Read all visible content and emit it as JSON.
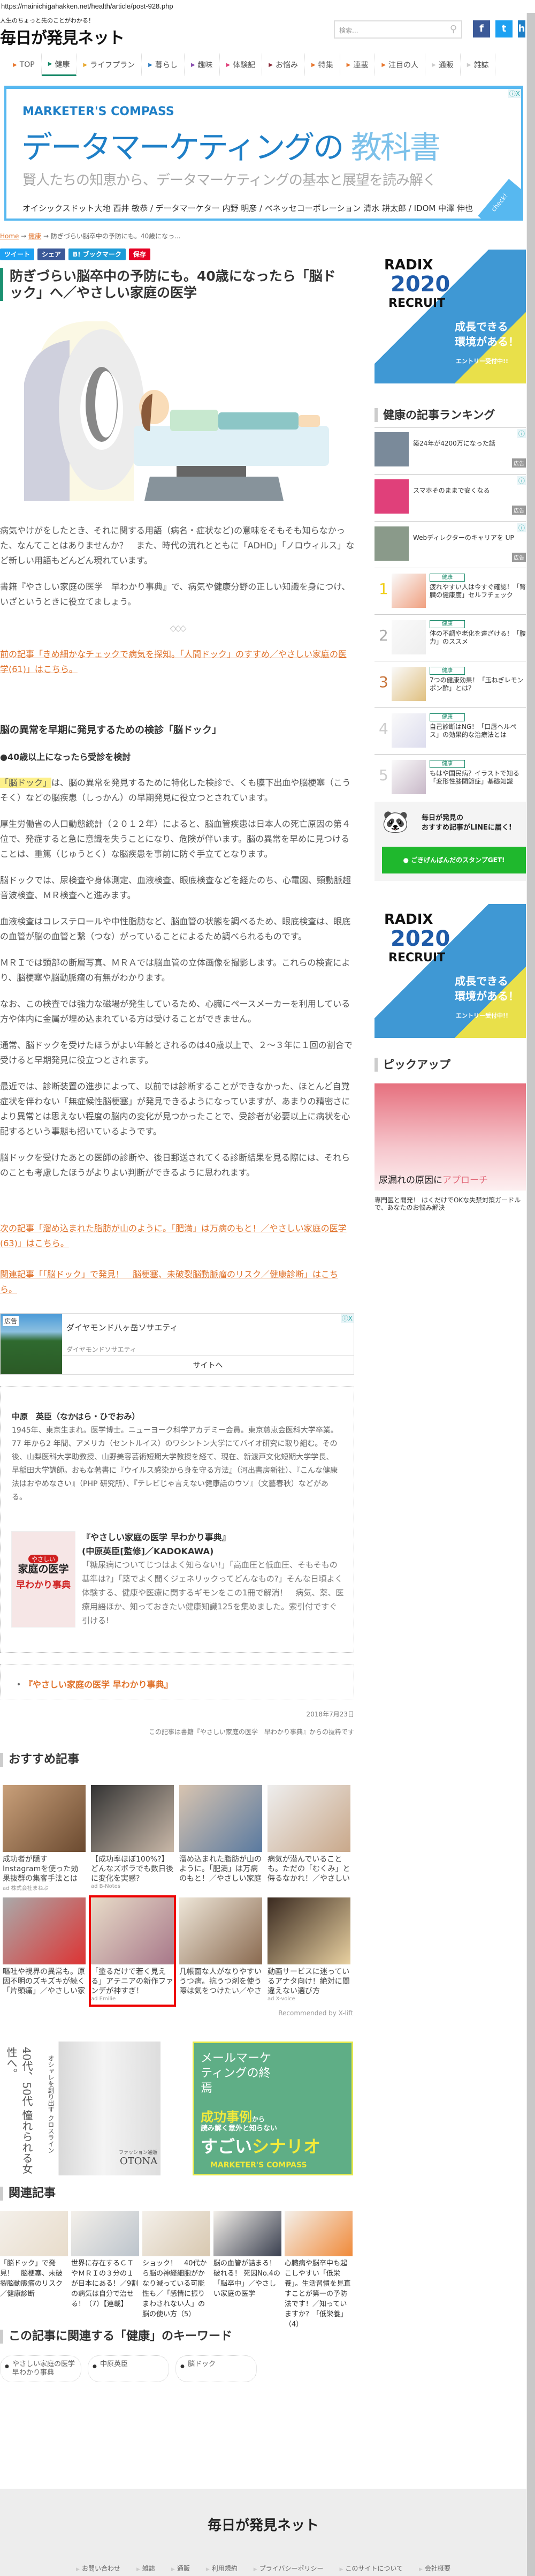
{
  "browser": {
    "url": "https://mainichigahakken.net/health/article/post-928.php"
  },
  "header": {
    "tagline": "人生のちょっと先のことがわかる！",
    "logo": "毎日が発見ネット",
    "search_placeholder": "検索...",
    "social": [
      "f",
      "t",
      "h"
    ]
  },
  "nav": [
    {
      "label": "TOP",
      "color": "#e8772e"
    },
    {
      "label": "健康",
      "color": "#1a8a6a",
      "active": true
    },
    {
      "label": "ライフプラン",
      "color": "#e8a82e"
    },
    {
      "label": "暮らし",
      "color": "#2b7bc0"
    },
    {
      "label": "趣味",
      "color": "#8a4fb0"
    },
    {
      "label": "体験記",
      "color": "#e0407a"
    },
    {
      "label": "お悩み",
      "color": "#8a2b3a"
    },
    {
      "label": "特集",
      "color": "#e8772e"
    },
    {
      "label": "連載",
      "color": "#e8772e"
    },
    {
      "label": "注目の人",
      "color": "#e8772e"
    },
    {
      "label": "通販",
      "color": "#ccc"
    },
    {
      "label": "雑誌",
      "color": "#ccc"
    }
  ],
  "top_ad": {
    "brand": "MARKETER'S COMPASS",
    "headline": "データマーケティングの",
    "headline_accent": "教科書",
    "sub": "賢人たちの知恵から、データマーケティングの基本と展望を読み解く",
    "names": "オイシックスドット大地 西井 敏恭 / データマーケター 内野 明彦 / ベネッセコーポレーション 清水 耕太郎 / IDOM 中澤 伸也",
    "check": "check!",
    "info": "ⓘX"
  },
  "breadcrumb": {
    "home": "Home",
    "cat": "健康",
    "current": "防ぎづらい脳卒中の予防にも。40歳になっ...",
    "sep": "→"
  },
  "share": [
    {
      "label": "ツイート",
      "color": "#1da1f2"
    },
    {
      "label": "シェア",
      "color": "#3b5998"
    },
    {
      "label": "B! ブックマーク",
      "color": "#1e9bd7"
    },
    {
      "label": "保存",
      "color": "#e60023"
    }
  ],
  "article": {
    "title": "防ぎづらい脳卒中の予防にも。40歳になったら「脳ドック」へ／やさしい家庭の医学",
    "intro": [
      "病気やけがをしたとき、それに関する用語（病名・症状など)の意味をそもそも知らなかった、なんてことはありませんか？　また、時代の流れとともに「ADHD」「ノロウィルス」など新しい用語もどんどん現れています。",
      "書籍『やさしい家庭の医学　早わかり事典』で、病気や健康分野の正しい知識を身につけ、いざというときに役立てましょう。"
    ],
    "divider": "◇◇◇",
    "prev_link": "前の記事「きめ細かなチェックで病気を探知。「人間ドック」のすすめ／やさしい家庭の医学(61)」はこちら。",
    "h3": "脳の異常を早期に発見するための検診「脳ドック」",
    "h4": "●40歳以上になったら受診を検討",
    "p1_highlight": "「脳ドック」",
    "p1_rest": "は、脳の異常を発見するために特化した検診で、くも膜下出血や脳梗塞（こうそく）などの脳疾患（しっかん）の早期発見に役立つとされています。",
    "paras": [
      "厚生労働省の人口動態統計（２０１２年）によると、脳血管疾患は日本人の死亡原因の第４位で、発症すると急に意識を失うことになり、危険が伴います。脳の異常を早めに見つけることは、重篤（じゅうとく）な脳疾患を事前に防ぐ手立てとなります。",
      "脳ドックでは、尿検査や身体測定、血液検査、眼底検査などを経たのち、心電図、頸動脈超音波検査、ＭＲ検査へと進みます。",
      "血液検査はコレステロールや中性脂肪など、脳血管の状態を調べるため、眼底検査は、眼底の血管が脳の血管と繋（つな）がっていることによるため調べられるものです。",
      "ＭＲＩでは頭部の断層写真、ＭＲＡでは脳血管の立体画像を撮影します。これらの検査により、脳梗塞や脳動脈瘤の有無がわかります。",
      "なお、この検査では強力な磁場が発生しているため、心臓にペースメーカーを利用している方や体内に金属が埋め込まれている方は受けることができません。",
      "通常、脳ドックを受けたほうがよい年齢とされるのは40歳以上で、２～３年に１回の割合で受けると早期発見に役立つとされます。",
      "最近では、診断装置の進歩によって、以前では診断することができなかった、ほとんど自覚症状を伴わない「無症候性脳梗塞」が発見できるようになっていますが、あまりの精密さにより異常とは思えない程度の脳内の変化が見つかったことで、受診者が必要以上に病状を心配するという事態も招いているようです。",
      "脳ドックを受けたあとの医師の診断や、後日郵送されてくる診断結果を見る際には、それらのことも考慮したほうがよりよい判断ができるように思われます。"
    ],
    "next_link": "次の記事「溜め込まれた脂肪が山のように。「肥満」は万病のもと！／やさしい家庭の医学(63)」はこちら。",
    "related_link": "関連記事「「脳ドック」で発見！　脳梗塞、未破裂脳動脈瘤のリスク／健康診断」はこちら。"
  },
  "inline_ad": {
    "tag": "広告",
    "title": "ダイヤモンド八ヶ岳ソサエティ",
    "advertiser": "ダイヤモンドソサエティ",
    "button": "サイトへ",
    "info": "ⓘX"
  },
  "author": {
    "name": "中原　英臣（なかはら・ひでおみ）",
    "bio": "1945年、東京生まれ。医学博士。ニューヨーク科学アカデミー会員。東京慈恵会医科大学卒業。77 年から2 年間、アメリカ（セントルイス）のワシントン大学にてバイオ研究に取り組む。その後、山梨医科大学助教授、山野美容芸術短期大学教授を経て、現在、新渡戸文化短期大学学長、早稲田大学講師。おもな著書に『ウイルス感染から身を守る方法』（河出書房新社）、『こんな健康法はおやめなさい』（PHP 研究所）、『テレビじゃ言えない健康話のウソ』（文藝春秋）などがある。",
    "book_cover": {
      "small": "やさしい",
      "main": "家庭の医学",
      "sub": "早わかり事典"
    },
    "book_title": "『やさしい家庭の医学 早わかり事典』",
    "book_pub": "(中原英臣[監修]／KADOKAWA)",
    "book_desc": "「糖尿病についてじつはよく知らない!」「高血圧と低血圧、そもそもの基準は?」「薬でよく聞くジェネリックってどんなもの?」そんな日頃よく体験する、健康や医療に関するギモンをこの1冊で解消！　病気、薬、医療用語ほか、知っておきたい健康知識125を集めました。索引付ですぐ引ける!"
  },
  "book_list": [
    "『やさしい家庭の医学 早わかり事典』"
  ],
  "date": "2018年7月23日",
  "source_note": "この記事は書籍『やさしい家庭の医学　早わかり事典』からの抜粋です",
  "recommend": {
    "heading": "おすすめ記事",
    "items": [
      {
        "title": "成功者が隠すInstagramを使った効果抜群の集客手法とは",
        "ad": "ad 株式会社まねぶ"
      },
      {
        "title": "【成功率ほぼ100%?】どんなズボラでも数日後に変化を実感?",
        "ad": "ad B-Notes"
      },
      {
        "title": "溜め込まれた脂肪が山のように。「肥満」は万病のもと！／やさしい家庭",
        "ad": ""
      },
      {
        "title": "病気が潜んでいることも。ただの「むくみ」と侮るなかれ！／やさしい",
        "ad": ""
      },
      {
        "title": "嘔吐や視界の異常も。原因不明のズキズキが続く「片頭痛」／やさしい家",
        "ad": ""
      },
      {
        "title": "「塗るだけで若く見える」アテニアの新作ファンデが神すぎ！",
        "ad": "ad Emilie",
        "selected": true
      },
      {
        "title": "几帳面な人がなりやすいうつ病。抗うつ剤を使う際は気をつけたい／やさ",
        "ad": ""
      },
      {
        "title": "動画サービスに迷っているアナタ向け！絶対に間違えない選び方",
        "ad": "ad X-voice"
      }
    ],
    "credit": "Recommended by X-lift"
  },
  "bottom_ads": {
    "left": {
      "vertical_main": "40代、50代 憧れられる女性へ。",
      "vertical_sub": "オシャレを創り出す クロスライン",
      "brand": "OTONA",
      "shop": "ファッション通販"
    },
    "right": {
      "title": "メールマーケティングの終焉",
      "accent": "成功事例",
      "from": "から",
      "sub": "読み解く意外と知らない",
      "big1": "すごい",
      "big2": "シナリオ",
      "brand": "MARKETER'S COMPASS"
    }
  },
  "related": {
    "heading": "関連記事",
    "items": [
      "「脳ドック」で発見！　脳梗塞、未破裂脳動脈瘤のリスク／健康診断",
      "世界に存在するＣＴやＭＲＩの３分の１が日本にある！／9割の病気は自分で治せる！（7）【連載】",
      "ショック！　40代から脳の神経細胞がかなり減っている可能性も／「感情に振りまわされない人」の脳の使い方（5）",
      "脳の血管が詰まる！破れる！ 死因No.4の「脳卒中」／やさしい家庭の医学",
      "心臓病や脳卒中も起こしやすい「低栄養」。生活習慣を見直すことが第一の予防法です！／知っていますか？「低栄養」（4）"
    ]
  },
  "keywords": {
    "heading": "この記事に関連する「健康」のキーワード",
    "items": [
      "やさしい家庭の医学早わかり事典",
      "中原英臣",
      "脳ドック"
    ]
  },
  "footer": {
    "logo": "毎日が発見ネット",
    "links": [
      "お問い合わせ",
      "雑誌",
      "通販",
      "利用規約",
      "プライバシーポリシー",
      "このサイトについて",
      "会社概要"
    ]
  },
  "sidebar": {
    "radix": {
      "brand": "RADIX",
      "year": "2020",
      "recruit": "RECRUIT",
      "copy1": "成長できる",
      "copy2": "環境がある！",
      "entry": "エントリー受付中!!"
    },
    "ranking_heading": "健康の記事ランキング",
    "ads": [
      {
        "title": "築24年が4200万になった話",
        "badge": "広告"
      },
      {
        "title": "スマホそのままで安くなる",
        "badge": "広告"
      },
      {
        "title": "Webディレクターのキャリアを UP",
        "badge": "広告"
      }
    ],
    "ranking": [
      {
        "rank": "1",
        "cat": "健康",
        "title": "疲れやすい人は今すぐ確認！「腎臓の健康度」セルフチェック",
        "color": "#f0d020"
      },
      {
        "rank": "2",
        "cat": "健康",
        "title": "体の不調や老化を遠ざける！「腹力」のススメ",
        "color": "#aaa"
      },
      {
        "rank": "3",
        "cat": "健康",
        "title": "7つの健康効果！「玉ねぎレモンポン酢」とは？",
        "color": "#c8743a"
      },
      {
        "rank": "4",
        "cat": "健康",
        "title": "自己診断はNG！「口唇ヘルペス」の効果的な治療法とは",
        "color": "#ccc"
      },
      {
        "rank": "5",
        "cat": "健康",
        "title": "もはや国民病？イラストで知る「変形性膝関節症」基礎知識",
        "color": "#ccc"
      }
    ],
    "line": {
      "text1": "毎日が発見の",
      "text2": "おすすめ記事がLINEに届く!",
      "button": "ごきげんぱんだのスタンプGET!"
    },
    "pickup_heading": "ピックアップ",
    "pickup": {
      "overlay": "尿漏れの原因に",
      "overlay_accent": "アプローチ",
      "caption": "専門医と開発！ はくだけでOKな失禁対策ガードルで、あなたのお悩み解決"
    }
  }
}
